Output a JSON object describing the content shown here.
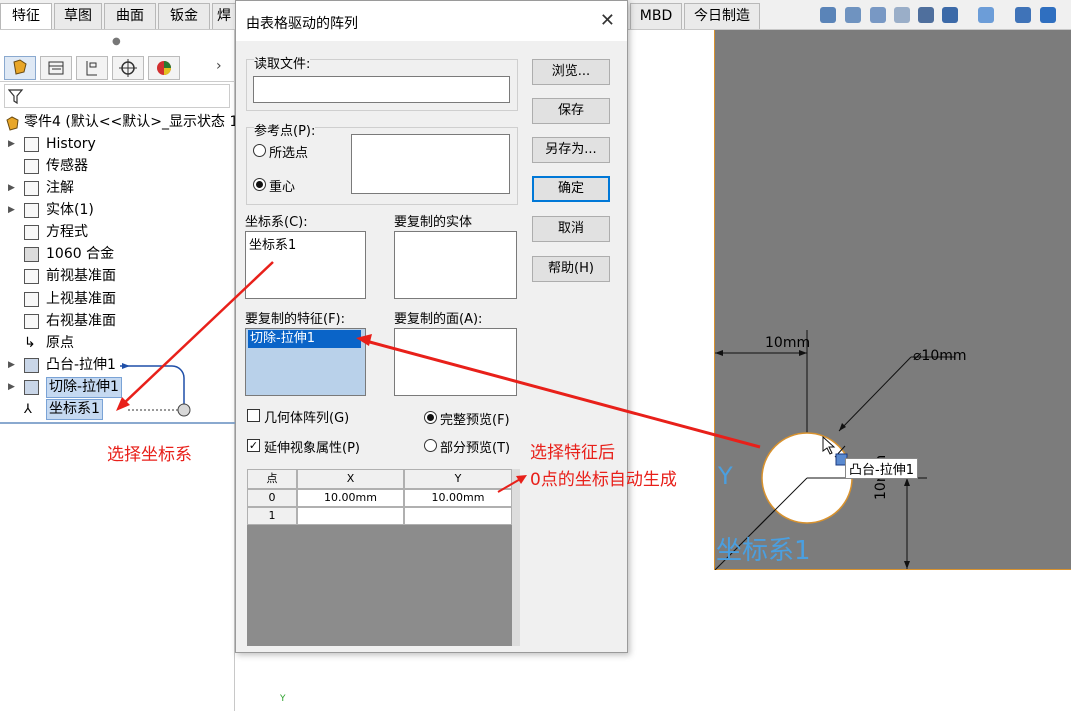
{
  "toolbar": {
    "tabs": [
      "特征",
      "草图",
      "曲面",
      "钣金",
      "焊",
      "MBD",
      "今日制造"
    ]
  },
  "feature_tree": {
    "part_name": "零件4 (默认<<默认>_显示状态 1",
    "items": [
      {
        "label": "History",
        "has_arrow": true,
        "icon": "history-folder-icon"
      },
      {
        "label": "传感器",
        "has_arrow": false,
        "icon": "sensor-folder-icon"
      },
      {
        "label": "注解",
        "has_arrow": true,
        "icon": "annotation-icon"
      },
      {
        "label": "实体(1)",
        "has_arrow": true,
        "icon": "solid-body-folder-icon"
      },
      {
        "label": "方程式",
        "has_arrow": false,
        "icon": "equation-icon"
      },
      {
        "label": "1060 合金",
        "has_arrow": false,
        "icon": "material-icon"
      },
      {
        "label": "前视基准面",
        "has_arrow": false,
        "icon": "plane-icon"
      },
      {
        "label": "上视基准面",
        "has_arrow": false,
        "icon": "plane-icon"
      },
      {
        "label": "右视基准面",
        "has_arrow": false,
        "icon": "plane-icon"
      },
      {
        "label": "原点",
        "has_arrow": false,
        "icon": "origin-icon"
      },
      {
        "label": "凸台-拉伸1",
        "has_arrow": true,
        "icon": "boss-extrude-icon"
      },
      {
        "label": "切除-拉伸1",
        "has_arrow": true,
        "icon": "cut-extrude-icon"
      },
      {
        "label": "坐标系1",
        "has_arrow": false,
        "icon": "coordinate-system-icon"
      }
    ]
  },
  "dialog": {
    "title": "由表格驱动的阵列",
    "read_file_label": "读取文件:",
    "read_file_value": "",
    "ref_point_label": "参考点(P):",
    "ref_option_selected": "所选点",
    "ref_option_centroid": "重心",
    "coord_sys_label": "坐标系(C):",
    "coord_sys_value": "坐标系1",
    "bodies_label": "要复制的实体",
    "features_label": "要复制的特征(F):",
    "features_value": "切除-拉伸1",
    "faces_label": "要复制的面(A):",
    "geometry_pattern": "几何体阵列(G)",
    "propagate_visual": "延伸视象属性(P)",
    "full_preview": "完整预览(F)",
    "partial_preview": "部分预览(T)",
    "buttons": {
      "browse": "浏览...",
      "save": "保存",
      "save_as": "另存为...",
      "ok": "确定",
      "cancel": "取消",
      "help": "帮助(H)"
    },
    "table": {
      "headers": [
        "点",
        "X",
        "Y"
      ],
      "rows": [
        [
          "0",
          "10.00mm",
          "10.00mm"
        ],
        [
          "1",
          "",
          ""
        ]
      ]
    }
  },
  "graphics": {
    "dim_horizontal": "10mm",
    "dim_diameter": "⌀10mm",
    "dim_vertical": "10mm",
    "feature_tag": "凸台-拉伸1",
    "coord_label": "坐标系1",
    "axis_y": "Y"
  },
  "annotations": {
    "left_note": "选择坐标系",
    "right_note_line1": "选择特征后",
    "right_note_line2": "0点的坐标自动生成"
  }
}
